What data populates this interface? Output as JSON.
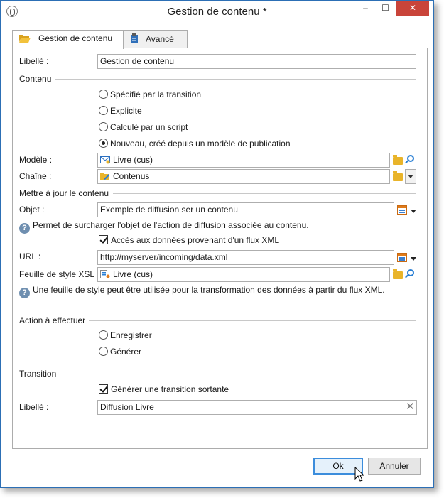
{
  "window": {
    "title": "Gestion de contenu *"
  },
  "controls": {
    "minimize": "–",
    "maximize": "☐",
    "close": "✕"
  },
  "tabs": [
    {
      "label": "Gestion de contenu",
      "icon": "folder-open-icon",
      "active": true
    },
    {
      "label": "Avancé",
      "icon": "clipboard-icon",
      "active": false
    }
  ],
  "form": {
    "libelle_label": "Libellé :",
    "libelle_value": "Gestion de contenu",
    "contenu_section": "Contenu",
    "radios": [
      {
        "label": "Spécifié par la transition",
        "checked": false
      },
      {
        "label": "Explicite",
        "checked": false
      },
      {
        "label": "Calculé par un script",
        "checked": false
      },
      {
        "label": "Nouveau, créé depuis un modèle de publication",
        "checked": true
      }
    ],
    "modele_label": "Modèle :",
    "modele_value": "Livre (cus)",
    "chaine_label": "Chaîne :",
    "chaine_value": "Contenus",
    "maj_section": "Mettre à jour le contenu",
    "objet_label": "Objet :",
    "objet_value": "Exemple de diffusion ser un contenu",
    "objet_info": "Permet de surcharger l'objet de l'action de diffusion associée au contenu.",
    "acces_xml_label": "Accès aux données provenant d'un flux XML",
    "acces_xml_checked": true,
    "url_label": "URL :",
    "url_value": "http://myserver/incoming/data.xml",
    "xsl_label": "Feuille de style XSL :",
    "xsl_value": "Livre (cus)",
    "xsl_info": "Une feuille de style peut être utilisée pour la transformation des données à partir du flux XML.",
    "action_section": "Action à effectuer",
    "action_radios": [
      {
        "label": "Enregistrer",
        "checked": false
      },
      {
        "label": "Générer",
        "checked": false
      }
    ],
    "transition_section": "Transition",
    "transition_check_label": "Générer une transition sortante",
    "transition_checked": true,
    "transition_libelle_label": "Libellé :",
    "transition_libelle_value": "Diffusion Livre"
  },
  "buttons": {
    "ok": "Ok",
    "cancel": "Annuler"
  },
  "colors": {
    "accent": "#3c8ddc",
    "close_bg": "#c9443a",
    "folder": "#e9b42a",
    "search": "#2a7fd4"
  }
}
